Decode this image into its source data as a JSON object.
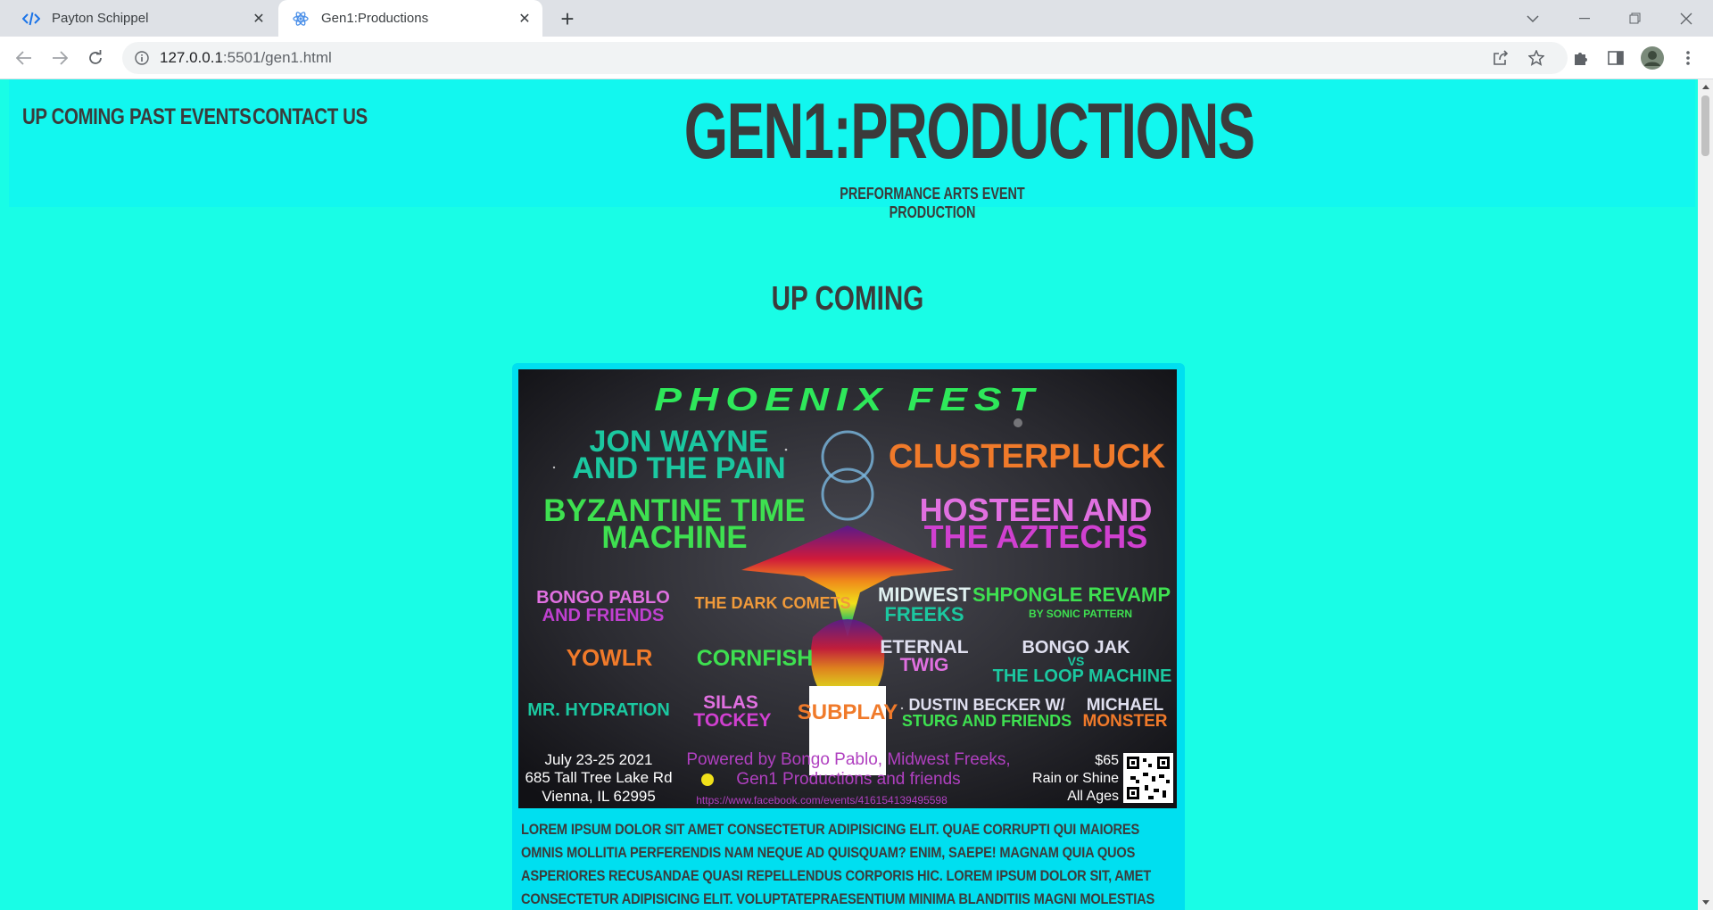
{
  "browser": {
    "tabs": [
      {
        "title": "Payton Schippel",
        "icon": "code-icon",
        "active": false
      },
      {
        "title": "Gen1:Productions",
        "icon": "react-icon",
        "active": true
      }
    ],
    "url_host": "127.0.0.1",
    "url_rest": ":5501/gen1.html"
  },
  "site": {
    "nav": [
      "UP COMING",
      "PAST EVENTS",
      "CONTACT US"
    ],
    "brand": "GEN1:PRODUCTIONS",
    "tagline": "PREFORMANCE ARTS EVENT PRODUCTION",
    "section_title": "UP COMING"
  },
  "poster": {
    "title": "PHOENIX FEST",
    "acts": [
      "JON WAYNE",
      "AND THE PAIN",
      "CLUSTERPLUCK",
      "BYZANTINE TIME",
      "MACHINE",
      "HOSTEEN AND",
      "THE AZTECHS",
      "BONGO PABLO",
      "AND FRIENDS",
      "THE DARK COMETS",
      "MIDWEST",
      "FREEKS",
      "SHPONGLE REVAMP",
      "BY SONIC PATTERN",
      "YOWLR",
      "CORNFISH",
      "ETERNAL",
      "TWIG",
      "BONGO JAK",
      "VS",
      "THE LOOP MACHINE",
      "MR. HYDRATION",
      "SILAS",
      "TOCKEY",
      "SUBPLAY",
      "DUSTIN BECKER W/",
      "STURG AND FRIENDS",
      "MICHAEL",
      "MONSTER"
    ],
    "date": "July 23-25 2021",
    "address1": "685 Tall Tree Lake Rd",
    "address2": "Vienna, IL 62995",
    "powered1": "Powered by Bongo Pablo, Midwest Freeks,",
    "powered2": "Gen1 Productions and friends",
    "fb_url": "https://www.facebook.com/events/416154139495598",
    "price": "$65",
    "rain": "Rain or Shine",
    "ages": "All Ages"
  },
  "description": "LOREM IPSUM DOLOR SIT AMET CONSECTETUR ADIPISICING ELIT. QUAE CORRUPTI QUI MAIORES OMNIS MOLLITIA PERFERENDIS NAM NEQUE AD QUISQUAM? ENIM, SAEPE! MAGNAM QUIA QUOS ASPERIORES RECUSANDAE QUASI REPELLENDUS CORPORIS HIC. LOREM IPSUM DOLOR SIT, AMET CONSECTETUR ADIPISICING ELIT. VOLUPTATEPRAESENTIUM MINIMA BLANDITIIS MAGNI MOLESTIAS ESSE CUM EAQUE RERUM QUAERATEXPLICABO! TEMPORE NIHIL NESCIUNT EAQUE?"
}
